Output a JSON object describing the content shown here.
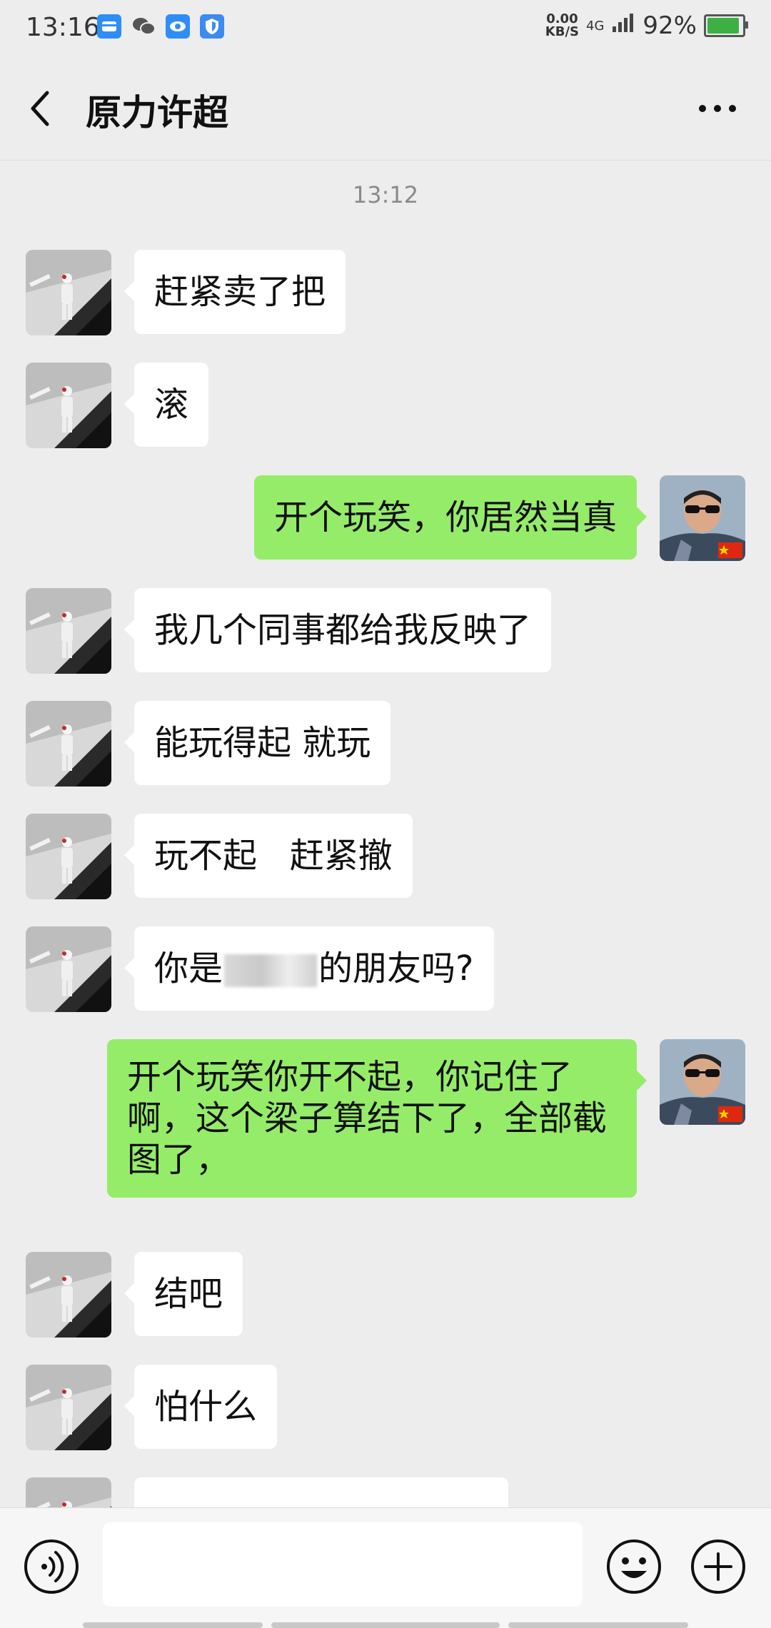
{
  "status_bar": {
    "time": "13:16",
    "net_speed_value": "0.00",
    "net_speed_unit": "KB/S",
    "network": "4G",
    "battery_percent": "92%",
    "battery_level": 0.92,
    "notification_icons": [
      "cloud-drive-icon",
      "wechat-icon",
      "eye-icon",
      "shield-icon"
    ]
  },
  "header": {
    "title": "原力许超",
    "back_icon": "chevron-left-icon",
    "more_icon": "more-dots-icon"
  },
  "chat": {
    "timestamp": "13:12",
    "messages": [
      {
        "side": "in",
        "text": "赶紧卖了把"
      },
      {
        "side": "in",
        "text": "滚"
      },
      {
        "side": "out",
        "text": "开个玩笑，你居然当真"
      },
      {
        "side": "in",
        "text": "我几个同事都给我反映了"
      },
      {
        "side": "in",
        "text": "能玩得起 就玩"
      },
      {
        "side": "in",
        "text": "玩不起   赶紧撤"
      },
      {
        "side": "in",
        "text_before": "你是",
        "text_after": "的朋友吗?"
      },
      {
        "side": "out",
        "text": "开个玩笑你开不起，你记住了啊，这个梁子算结下了，全部截图了，"
      },
      {
        "side": "in",
        "text": "结吧"
      },
      {
        "side": "in",
        "text": "怕什么"
      }
    ]
  },
  "input_bar": {
    "voice_icon": "voice-icon",
    "emoji_icon": "emoji-icon",
    "plus_icon": "plus-icon",
    "placeholder": ""
  },
  "colors": {
    "background": "#ededed",
    "incoming_bubble": "#ffffff",
    "outgoing_bubble": "#95ec69"
  }
}
